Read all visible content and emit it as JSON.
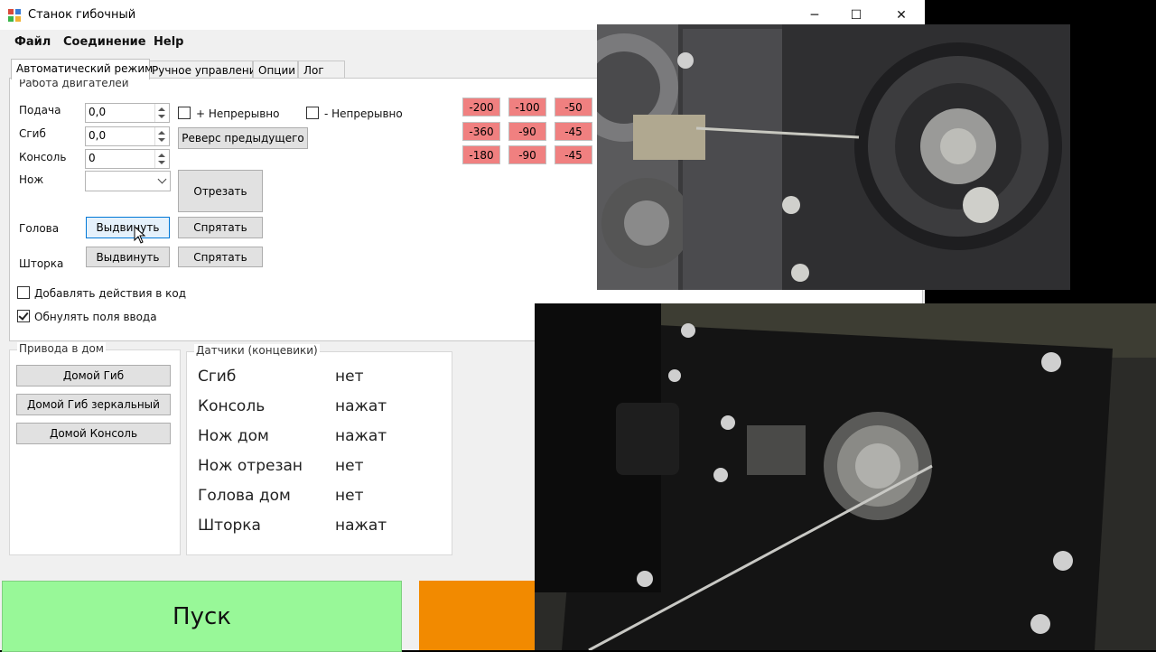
{
  "window": {
    "title": "Станок гибочный",
    "controls": {
      "minimize": "─",
      "maximize": "☐",
      "close": "✕"
    }
  },
  "menu": [
    "Файл",
    "Соединение",
    "Help"
  ],
  "tabs": [
    {
      "label": "Автоматический режим",
      "active": true
    },
    {
      "label": "Ручное управление",
      "active": false
    },
    {
      "label": "Опции",
      "active": false
    },
    {
      "label": "Лог",
      "active": false
    }
  ],
  "motors": {
    "group_title": "Работа двигателей",
    "feed_label": "Подача",
    "feed_value": "0,0",
    "bend_label": "Сгиб",
    "bend_value": "0,0",
    "console_label": "Консоль",
    "console_value": "0",
    "knife_label": "Нож",
    "knife_value": "",
    "plus_continuous": "+ Непрерывно",
    "minus_continuous": "- Непрерывно",
    "reverse_button": "Реверс предыдущего",
    "cut_button": "Отрезать",
    "head_label": "Голова",
    "head_extend": "Выдвинуть",
    "head_hide": "Спрятать",
    "shutter_label": "Шторка",
    "shutter_extend": "Выдвинуть",
    "shutter_hide": "Спрятать",
    "add_to_code": {
      "label": "Добавлять действия в код",
      "checked": false
    },
    "reset_fields": {
      "label": "Обнулять поля ввода",
      "checked": true
    }
  },
  "quick_buttons": [
    [
      "-200",
      "-100",
      "-50"
    ],
    [
      "-360",
      "-90",
      "-45"
    ],
    [
      "-180",
      "-90",
      "-45"
    ]
  ],
  "homing": {
    "group_title": "Привода в дом",
    "buttons": [
      "Домой Гиб",
      "Домой Гиб зеркальный",
      "Домой Консоль"
    ]
  },
  "sensors": {
    "group_title": "Датчики (концевики)",
    "rows": [
      {
        "name": "Сгиб",
        "state": "нет"
      },
      {
        "name": "Консоль",
        "state": "нажат"
      },
      {
        "name": "Нож дом",
        "state": "нажат"
      },
      {
        "name": "Нож отрезан",
        "state": "нет"
      },
      {
        "name": "Голова дом",
        "state": "нет"
      },
      {
        "name": "Шторка",
        "state": "нажат"
      }
    ]
  },
  "start_button": "Пуск",
  "colors": {
    "quick_button": "#f08080",
    "start": "#98f898",
    "stop": "#f28a00"
  }
}
